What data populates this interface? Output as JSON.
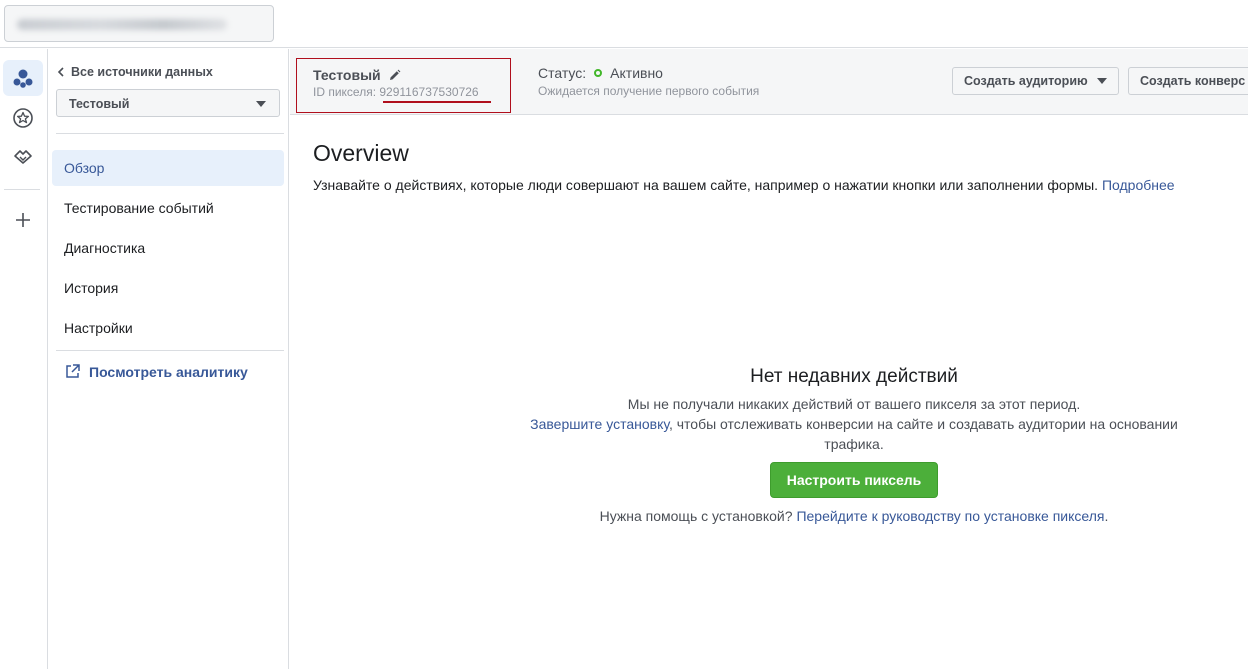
{
  "rail": {
    "items": [
      "events-manager-icon",
      "star-icon",
      "partners-icon"
    ],
    "add_icon": "plus-icon"
  },
  "nav": {
    "back_label": "Все источники данных",
    "source_selected": "Тестовый",
    "items": [
      {
        "label": "Обзор",
        "active": true
      },
      {
        "label": "Тестирование событий",
        "active": false
      },
      {
        "label": "Диагностика",
        "active": false
      },
      {
        "label": "История",
        "active": false
      },
      {
        "label": "Настройки",
        "active": false
      }
    ],
    "analytics_label": "Посмотреть аналитику"
  },
  "header": {
    "pixel_name": "Тестовый",
    "pixel_id_label": "ID пикселя:",
    "pixel_id": "929116737530726",
    "status_label": "Статус:",
    "status_value": "Активно",
    "status_sub": "Ожидается получение первого события",
    "create_audience": "Создать аудиторию",
    "create_conversion": "Создать конверс"
  },
  "main": {
    "title": "Overview",
    "description": "Узнавайте о действиях, которые люди совершают на вашем сайте, например о нажатии кнопки или заполнении формы.",
    "learn_more": "Подробнее",
    "empty_title": "Нет недавних действий",
    "empty_line1": "Мы не получали никаких действий от вашего пикселя за этот период.",
    "finish_setup_link": "Завершите установку",
    "empty_line2_rest": ", чтобы отслеживать конверсии на сайте и создавать аудитории на основании трафика.",
    "setup_button": "Настроить пиксель",
    "help_text": "Нужна помощь с установкой?",
    "help_link": "Перейдите к руководству по установке пикселя",
    "help_end": "."
  },
  "colors": {
    "accent": "#385898",
    "active_bg": "#e7f0fb",
    "success": "#42b72a",
    "button_green": "#4caf3a",
    "highlight_red": "#b00f1d"
  }
}
